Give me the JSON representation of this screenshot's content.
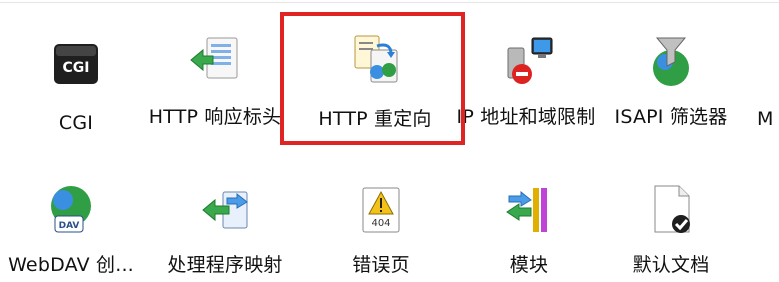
{
  "features_row1": [
    {
      "name": "CGI",
      "icon": "cgi-icon"
    },
    {
      "name": "HTTP 响应标头",
      "icon": "http-response-headers-icon"
    },
    {
      "name": "HTTP 重定向",
      "icon": "http-redirect-icon"
    },
    {
      "name": "IP 地址和域限制",
      "icon": "ip-domain-restrictions-icon"
    },
    {
      "name": "ISAPI 筛选器",
      "icon": "isapi-filters-icon"
    },
    {
      "name": "M",
      "icon": ""
    }
  ],
  "features_row2": [
    {
      "name": "WebDAV 创...",
      "icon": "webdav-icon"
    },
    {
      "name": "处理程序映射",
      "icon": "handler-mappings-icon"
    },
    {
      "name": "错误页",
      "icon": "error-pages-icon"
    },
    {
      "name": "模块",
      "icon": "modules-icon"
    },
    {
      "name": "默认文档",
      "icon": "default-document-icon"
    }
  ],
  "highlight_target": "HTTP 重定向",
  "colors": {
    "highlight": "#e02424",
    "background": "#ffffff"
  }
}
